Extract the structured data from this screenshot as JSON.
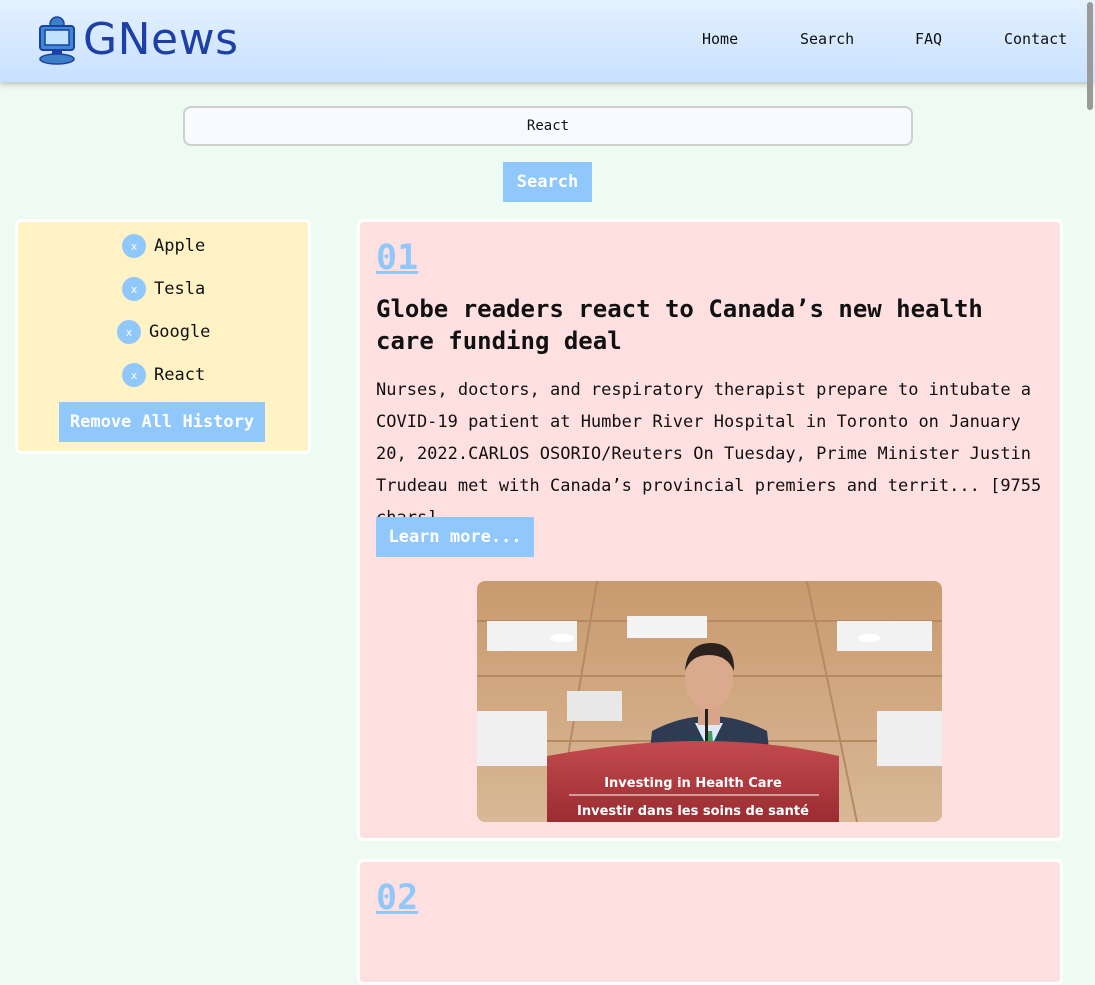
{
  "header": {
    "brand": "GNews",
    "nav": [
      "Home",
      "Search",
      "FAQ",
      "Contact"
    ]
  },
  "search": {
    "value": "React",
    "button_label": "Search"
  },
  "history": {
    "items": [
      "Apple",
      "Tesla",
      "Google",
      "React"
    ],
    "remove_icon_label": "x",
    "remove_all_label": "Remove All History"
  },
  "articles": [
    {
      "number": "01",
      "title": "Globe readers react to Canada’s new health care funding deal",
      "description": "Nurses, doctors, and respiratory therapist prepare to intubate a COVID-19 patient at Humber River Hospital in Toronto on January 20, 2022.CARLOS OSORIO/Reuters On Tuesday, Prime Minister Justin Trudeau met with Canada’s provincial premiers and territ... [9755 chars]",
      "button_label": "Learn more...",
      "image_caption_line1": "Investing in Health Care",
      "image_caption_line2": "Investir dans les soins de santé"
    },
    {
      "number": "02"
    }
  ],
  "colors": {
    "accent": "#90c8fb",
    "page_bg": "#eefbf2",
    "history_bg": "#fff3c6",
    "article_bg": "#ffe0e1",
    "brand": "#1e3fa6"
  }
}
